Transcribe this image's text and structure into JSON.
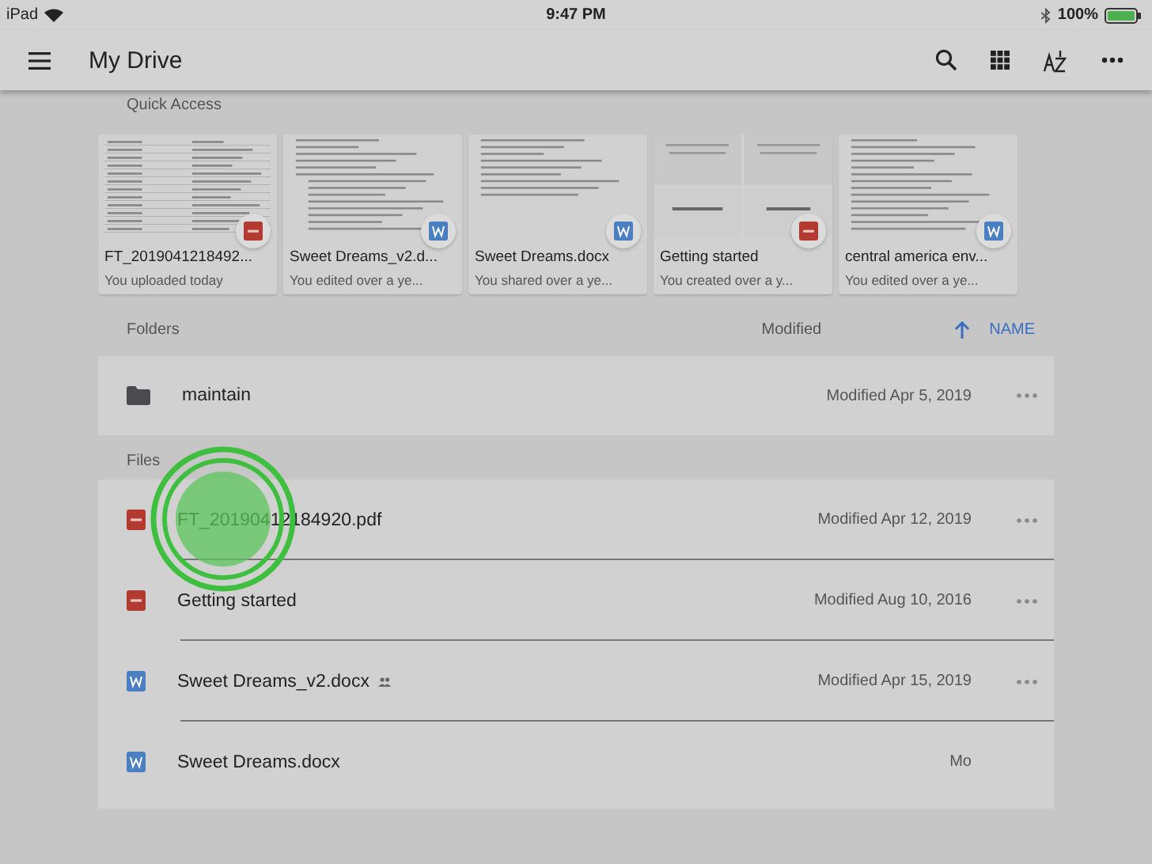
{
  "status_bar": {
    "device": "iPad",
    "time": "9:47 PM",
    "battery": "100%"
  },
  "app_bar": {
    "title": "My Drive"
  },
  "quick_access": {
    "label": "Quick Access",
    "cards": [
      {
        "name": "FT_2019041218492...",
        "detail": "You uploaded today",
        "kind": "pdf"
      },
      {
        "name": "Sweet Dreams_v2.d...",
        "detail": "You edited over a ye...",
        "kind": "word"
      },
      {
        "name": "Sweet Dreams.docx",
        "detail": "You shared over a ye...",
        "kind": "word"
      },
      {
        "name": "Getting started",
        "detail": "You created over a y...",
        "kind": "pdf"
      },
      {
        "name": "central america env...",
        "detail": "You edited over a ye...",
        "kind": "word"
      }
    ]
  },
  "folders": {
    "label": "Folders",
    "sort_column": "Modified",
    "sort_name": "NAME",
    "items": [
      {
        "name": "maintain",
        "modified": "Modified Apr 5, 2019"
      }
    ]
  },
  "files": {
    "label": "Files",
    "items": [
      {
        "name": "FT_20190412184920.pdf",
        "modified": "Modified Apr 12, 2019",
        "kind": "pdf",
        "shared": false,
        "tapped": true
      },
      {
        "name": "Getting started",
        "modified": "Modified Aug 10, 2016",
        "kind": "pdf",
        "shared": false,
        "tapped": false
      },
      {
        "name": "Sweet Dreams_v2.docx",
        "modified": "Modified Apr 15, 2019",
        "kind": "word",
        "shared": true,
        "tapped": false
      },
      {
        "name": "Sweet Dreams.docx",
        "modified": "Mo",
        "kind": "word",
        "shared": false,
        "tapped": false
      }
    ]
  }
}
